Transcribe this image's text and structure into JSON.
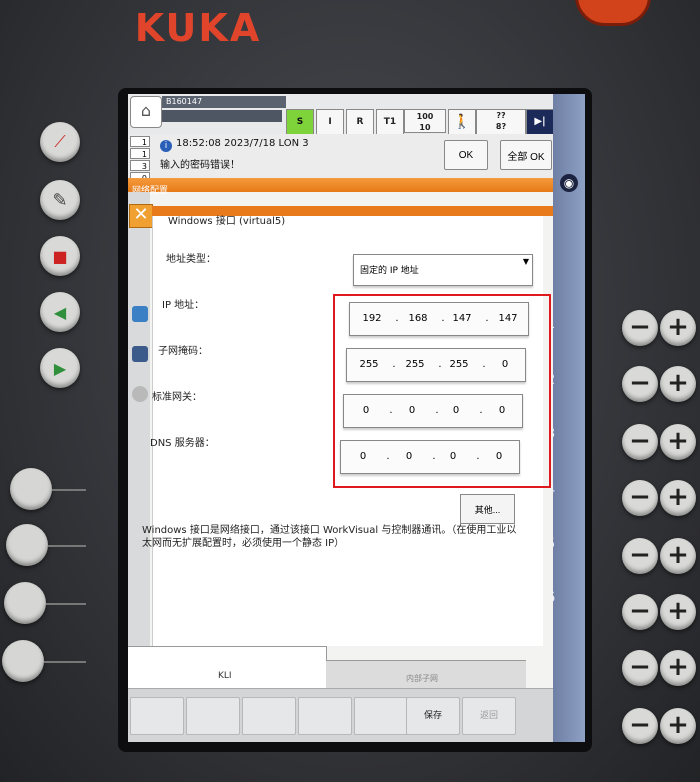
{
  "device": {
    "brand": "KUKA"
  },
  "status_bar": {
    "robot_name": "B160147",
    "mode_s": "S",
    "mode_i": "I",
    "mode_r": "R",
    "mode_t1": "T1",
    "override": "100",
    "jog_override": "10",
    "tool_line1": "??",
    "tool_line2": "8?",
    "infinity": "∞"
  },
  "messages": {
    "counts": [
      "1",
      "1",
      "3",
      "0"
    ],
    "time": "18:52:08 2023/7/18 LON 3",
    "text": "输入的密码错误！",
    "ok_label": "OK",
    "ok_all_label": "全部 OK"
  },
  "window": {
    "title": "网络配置",
    "interface_name": "Windows 接口 (virtual5)"
  },
  "form": {
    "address_type_label": "地址类型：",
    "address_type_value": "固定的 IP 地址",
    "ip_label": "IP 地址：",
    "ip": [
      "192",
      "168",
      "147",
      "147"
    ],
    "subnet_label": "子网掩码：",
    "subnet": [
      "255",
      "255",
      "255",
      "0"
    ],
    "gateway_label": "标准网关：",
    "gateway": [
      "0",
      "0",
      "0",
      "0"
    ],
    "dns_label": "DNS 服务器：",
    "dns": [
      "0",
      "0",
      "0",
      "0"
    ],
    "other_button": "其他...",
    "description": "Windows 接口是网络接口，通过该接口 WorkVisual 与控制器通讯。（在使用工业以太网而无扩展配置时，必须使用一个静态 IP）"
  },
  "tabs": {
    "kli": "KLI",
    "internal": "内部子网"
  },
  "bottom_bar": {
    "save": "保存",
    "back": "返回"
  },
  "axes": [
    "A1",
    "A2",
    "A3",
    "A4",
    "A5",
    "A6"
  ],
  "colors": {
    "highlight": "#e0191e",
    "title_orange": "#e87a1c",
    "mode_green": "#7ed23a"
  },
  "icons": [
    "estop-icon",
    "pencil-icon",
    "stop-icon",
    "play-back-icon",
    "play-forward-icon",
    "globe-icon",
    "hand-icon",
    "info-icon",
    "close-icon",
    "walk-icon"
  ]
}
